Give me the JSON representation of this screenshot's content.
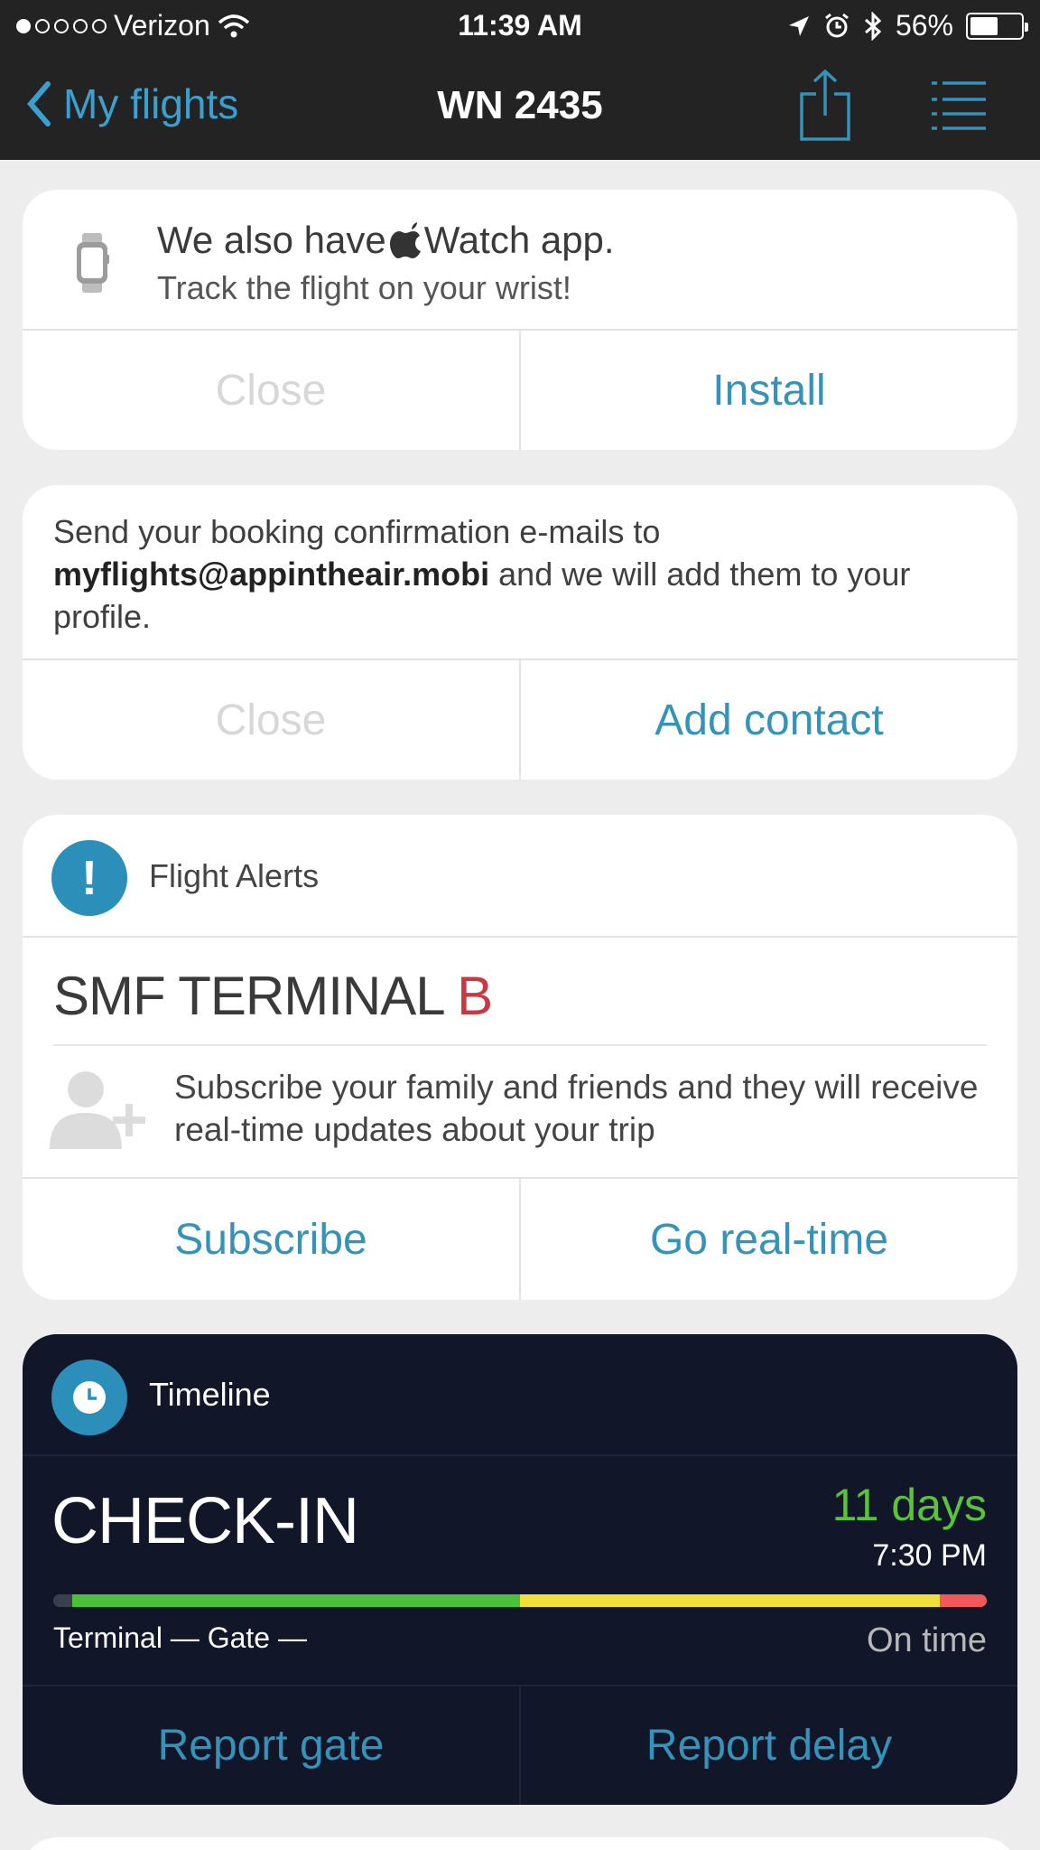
{
  "status_bar": {
    "carrier": "Verizon",
    "time": "11:39 AM",
    "battery": "56%",
    "battery_level": 0.56,
    "icons": [
      "wifi-icon",
      "location-arrow-icon",
      "alarm-icon",
      "bluetooth-icon",
      "battery-icon"
    ]
  },
  "nav": {
    "back_label": "My flights",
    "title": "WN 2435",
    "icons": [
      "chevron-left-icon",
      "share-icon",
      "menu-icon"
    ]
  },
  "watch_card": {
    "title_prefix": "We also have ",
    "title_suffix": "Watch app.",
    "subtitle": "Track the flight on your wrist!",
    "close_label": "Close",
    "install_label": "Install",
    "icons": [
      "apple-watch-icon",
      "apple-logo-icon"
    ]
  },
  "booking_card": {
    "text_before": "Send your booking confirmation e-mails to ",
    "email": "myflights@appintheair.mobi",
    "text_after": " and we will add them to your profile.",
    "close_label": "Close",
    "add_contact_label": "Add contact"
  },
  "alerts_card": {
    "header": "Flight Alerts",
    "alert_icon": "!",
    "terminal_text": "SMF TERMINAL ",
    "terminal_value": "B",
    "subscribe_text": "Subscribe your family and friends and they will receive real-time updates about your trip",
    "subscribe_label": "Subscribe",
    "realtime_label": "Go real-time",
    "icons": [
      "exclamation-icon",
      "add-person-icon"
    ]
  },
  "timeline_card": {
    "header": "Timeline",
    "stage": "CHECK-IN",
    "countdown": "11 days",
    "time": "7:30 PM",
    "terminal_gate": "Terminal — Gate —",
    "status": "On time",
    "report_gate_label": "Report gate",
    "report_delay_label": "Report delay",
    "progress_segments": [
      {
        "color": "#3a3f4d",
        "fraction": 0.02
      },
      {
        "color": "#4cc03a",
        "fraction": 0.48
      },
      {
        "color": "#f1e03c",
        "fraction": 0.45
      },
      {
        "color": "#f0585a",
        "fraction": 0.05
      }
    ],
    "icons": [
      "clock-icon"
    ]
  },
  "colors": {
    "accent": "#3592b9",
    "alert_red": "#c63a44",
    "countdown_green": "#5cc23e",
    "timeline_bg": "#111628",
    "top_bar_bg": "#232323"
  }
}
